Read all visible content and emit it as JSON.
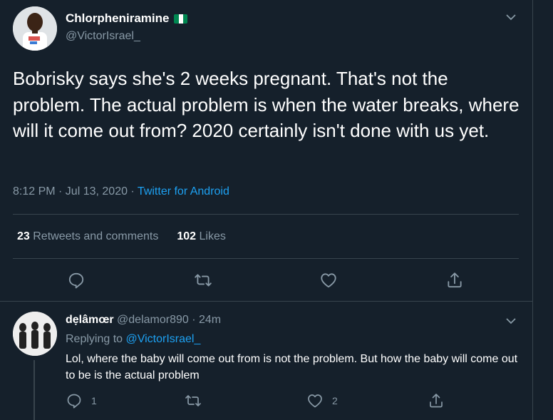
{
  "tweet": {
    "author_name": "Chlorpheniramine",
    "author_flag": "nigeria-flag",
    "author_handle": "@VictorIsrael_",
    "text": "Bobrisky says she's 2 weeks pregnant. That's not the problem. The actual problem is when the water breaks, where will it come out from? 2020 certainly isn't done with us yet.",
    "time": "8:12 PM · Jul 13, 2020 · ",
    "source": "Twitter for Android",
    "retweets_count": "23",
    "retweets_label": "Retweets and comments",
    "likes_count": "102",
    "likes_label": "Likes",
    "actions": [
      "reply-icon",
      "retweet-icon",
      "like-icon",
      "share-icon"
    ]
  },
  "reply": {
    "author_name": "dẹlâmœr",
    "author_handle": "@delamor890",
    "time": " · 24m",
    "replying_prefix": "Replying to ",
    "replying_to": "@VictorIsrael_",
    "text": "Lol, where the baby will come out from is not the problem. But how the baby will come out to be is the actual problem",
    "reply_count": "1",
    "retweet_count": "",
    "like_count": "2"
  },
  "colors": {
    "background": "#15202b",
    "divider": "#38444d",
    "secondary_text": "#8899a6",
    "link": "#1da1f2"
  }
}
